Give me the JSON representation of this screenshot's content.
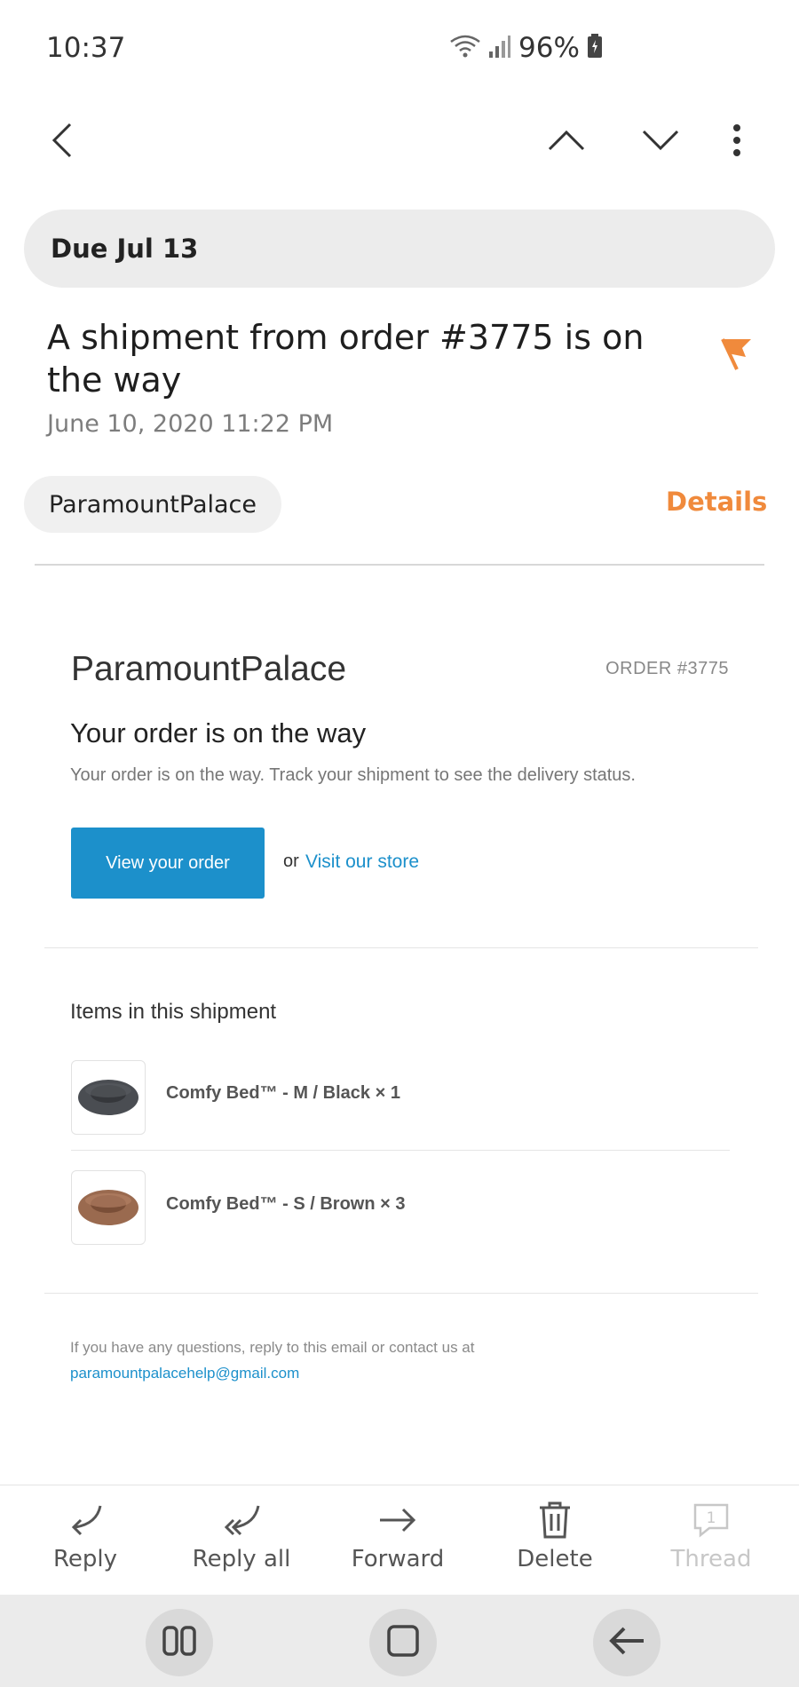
{
  "status_bar": {
    "time": "10:37",
    "battery": "96%"
  },
  "top_bar": {
    "back_icon": "chevron-left-icon",
    "prev_icon": "chevron-up-icon",
    "next_icon": "chevron-down-icon",
    "more_icon": "more-vertical-icon"
  },
  "due_label": "Due Jul 13",
  "subject": "A shipment from order #3775 is on the way",
  "date": "June 10, 2020  11:22 PM",
  "sender": "ParamountPalace",
  "details_label": "Details",
  "colors": {
    "accent_orange": "#f08a3c",
    "link_blue": "#1c90cb",
    "button_blue": "#1c90cb"
  },
  "email": {
    "shop_name": "ParamountPalace",
    "order_number": "ORDER #3775",
    "heading": "Your order is on the way",
    "body": "Your order is on the way. Track your shipment to see the delivery status.",
    "view_order_label": "View your order",
    "or_text": "or",
    "visit_store_label": "Visit our store",
    "items_heading": "Items in this shipment",
    "items": [
      {
        "label": "Comfy Bed™ - M / Black × 1",
        "color": "#4a4d52"
      },
      {
        "label": "Comfy Bed™ - S / Brown × 3",
        "color": "#9a6a4f"
      }
    ],
    "footer_text": "If you have any questions, reply to this email or contact us at",
    "footer_email": "paramountpalacehelp@gmail.com"
  },
  "actions": [
    {
      "label": "Reply",
      "icon": "reply-icon",
      "enabled": true
    },
    {
      "label": "Reply all",
      "icon": "reply-all-icon",
      "enabled": true
    },
    {
      "label": "Forward",
      "icon": "forward-icon",
      "enabled": true
    },
    {
      "label": "Delete",
      "icon": "trash-icon",
      "enabled": true
    },
    {
      "label": "Thread",
      "icon": "thread-icon",
      "badge": "1",
      "enabled": false
    }
  ],
  "nav_bar": {
    "recents_icon": "recents-icon",
    "home_icon": "home-icon",
    "back_icon": "back-arrow-icon"
  }
}
